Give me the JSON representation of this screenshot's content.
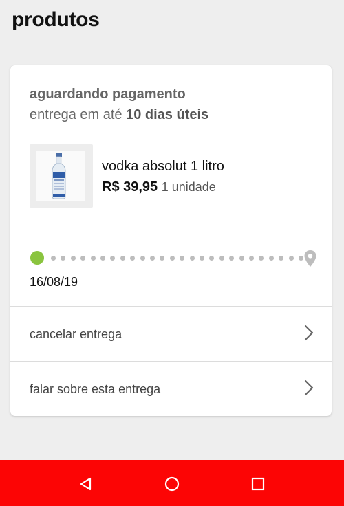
{
  "page": {
    "title": "produtos"
  },
  "order": {
    "status": "aguardando pagamento",
    "eta_prefix": "entrega em até",
    "eta_value": "10 dias úteis",
    "product": {
      "name": "vodka absolut 1 litro",
      "price": "R$ 39,95",
      "quantity": "1 unidade",
      "image_icon": "vodka-bottle-icon"
    },
    "tracking": {
      "start_color": "#8ac43f",
      "dot_color": "#bdbdbd",
      "end_icon": "location-pin-icon",
      "date": "16/08/19"
    },
    "actions": [
      {
        "label": "cancelar entrega",
        "icon": "chevron-right-icon"
      },
      {
        "label": "falar sobre esta entrega",
        "icon": "chevron-right-icon"
      }
    ]
  },
  "navbar": {
    "color": "#fc0505",
    "buttons": [
      "back-icon",
      "home-icon",
      "recents-icon"
    ]
  }
}
